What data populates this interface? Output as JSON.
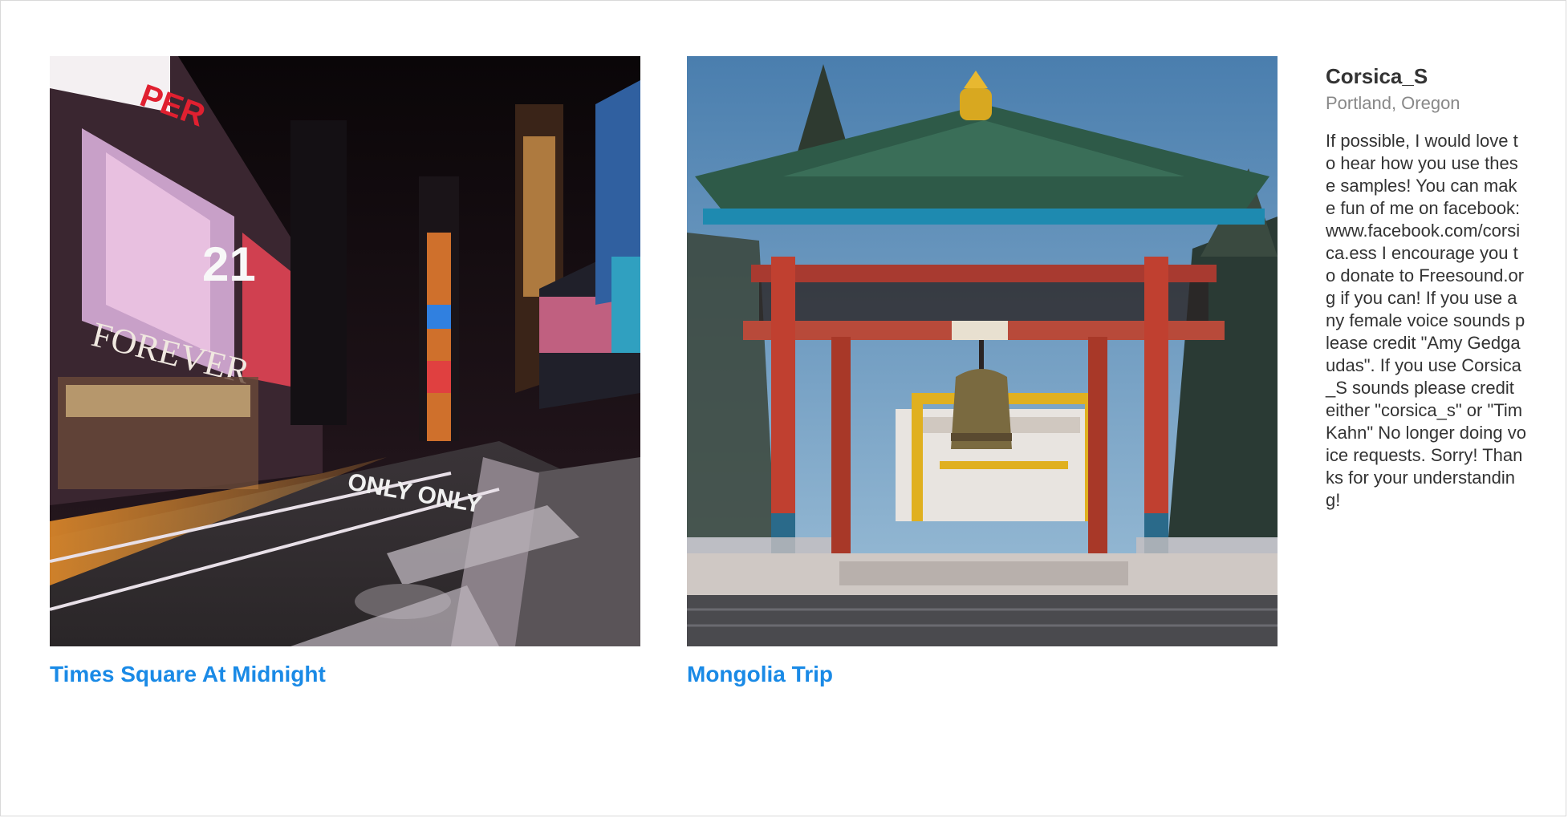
{
  "cards": [
    {
      "title": "Times Square At Midnight"
    },
    {
      "title": "Mongolia Trip"
    }
  ],
  "profile": {
    "name": "Corsica_S",
    "location": "Portland, Oregon",
    "bio": "If possible, I would love to hear how you use these samples! You can make fun of me on facebook: www.facebook.com/corsica.ess I encourage you to donate to Freesound.org if you can! If you use any female voice sounds please credit \"Amy Gedgaudas\". If you use Corsica_S sounds please credit either \"corsica_s\" or \"Tim Kahn\" No longer doing voice requests. Sorry! Thanks for your understanding!"
  },
  "colors": {
    "link": "#1a8ae6",
    "name": "#333333",
    "location": "#888888"
  }
}
